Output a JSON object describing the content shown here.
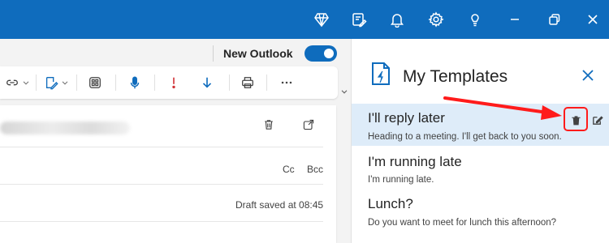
{
  "titlebar": {
    "icons": [
      "diamond-icon",
      "note-edit-icon",
      "bell-icon",
      "gear-icon",
      "lightbulb-icon",
      "minimize-icon",
      "restore-icon",
      "close-icon"
    ]
  },
  "header": {
    "new_outlook_label": "New Outlook",
    "new_outlook_enabled": true
  },
  "toolbar": {
    "icons": [
      "link-icon",
      "chevron-down-icon",
      "signature-icon",
      "chevron-down-icon",
      "apps-icon",
      "microphone-icon",
      "importance-high-icon",
      "importance-low-icon",
      "print-icon",
      "more-icon"
    ]
  },
  "compose": {
    "cc_label": "Cc",
    "bcc_label": "Bcc",
    "draft_status": "Draft saved at 08:45"
  },
  "panel": {
    "title": "My Templates",
    "templates": [
      {
        "title": "I'll reply later",
        "body": "Heading to a meeting. I'll get back to you soon."
      },
      {
        "title": "I'm running late",
        "body": "I'm running late."
      },
      {
        "title": "Lunch?",
        "body": "Do you want to meet for lunch this afternoon?"
      }
    ]
  },
  "colors": {
    "titlebar": "#0f6cbd",
    "selected_row": "#deecf9",
    "annotation": "#ff1b1b"
  }
}
